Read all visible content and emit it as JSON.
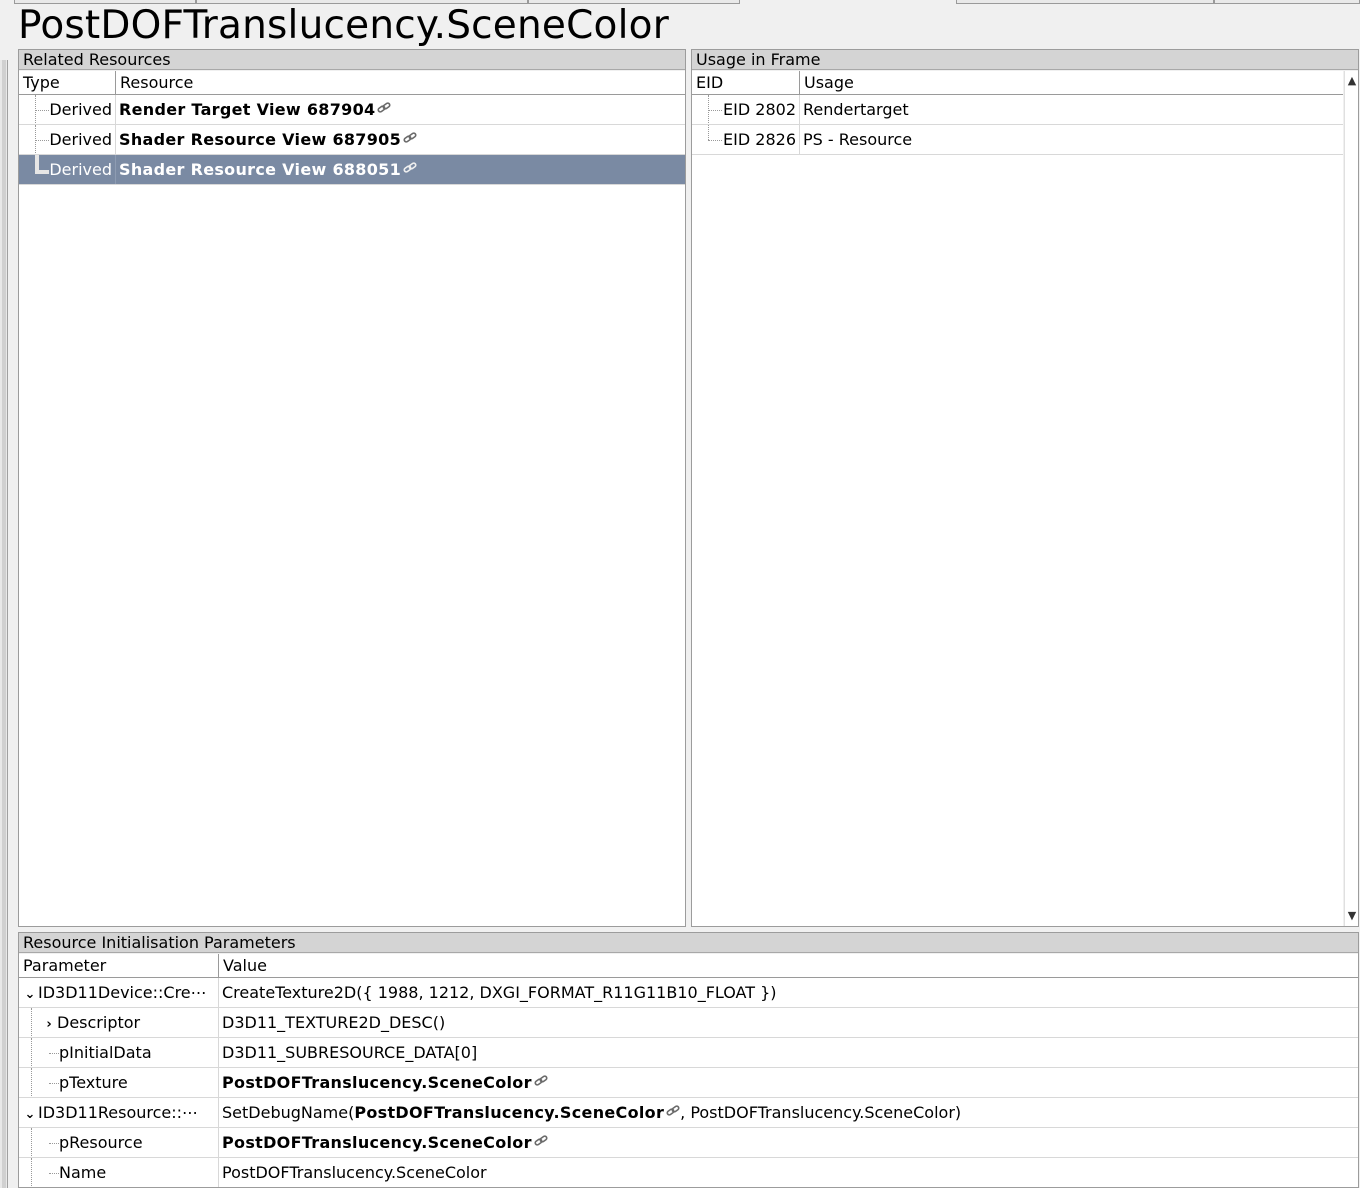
{
  "page": {
    "title": "PostDOFTranslucency.SceneColor"
  },
  "related": {
    "header": "Related Resources",
    "columns": [
      "Type",
      "Resource"
    ],
    "rows": [
      {
        "type": "Derived",
        "resource": "Render Target View 687904",
        "selected": false
      },
      {
        "type": "Derived",
        "resource": "Shader Resource View 687905",
        "selected": false
      },
      {
        "type": "Derived",
        "resource": "Shader Resource View 688051",
        "selected": true
      }
    ]
  },
  "usage": {
    "header": "Usage in Frame",
    "columns": [
      "EID",
      "Usage"
    ],
    "rows": [
      {
        "eid": "EID 2802",
        "usage": "Rendertarget"
      },
      {
        "eid": "EID 2826",
        "usage": "PS - Resource"
      }
    ]
  },
  "init": {
    "header": "Resource Initialisation Parameters",
    "columns": [
      "Parameter",
      "Value"
    ],
    "rows": [
      {
        "param": "ID3D11Device::Cre⋯",
        "value": "CreateTexture2D({ 1988, 1212, DXGI_FORMAT_R11G11B10_FLOAT })",
        "expander": "down"
      },
      {
        "param": "Descriptor",
        "value": "D3D11_TEXTURE2D_DESC()",
        "expander": "right"
      },
      {
        "param": "pInitialData",
        "value": "D3D11_SUBRESOURCE_DATA[0]"
      },
      {
        "param": "pTexture",
        "value": "PostDOFTranslucency.SceneColor",
        "link": true
      },
      {
        "param": "ID3D11Resource::⋯",
        "value_prefix": "SetDebugName(",
        "value_link": "PostDOFTranslucency.SceneColor",
        "value_suffix": ", PostDOFTranslucency.SceneColor)",
        "expander": "down"
      },
      {
        "param": "pResource",
        "value": "PostDOFTranslucency.SceneColor",
        "link": true
      },
      {
        "param": "Name",
        "value": "PostDOFTranslucency.SceneColor"
      }
    ]
  },
  "colors": {
    "selection": "#7a8aa3",
    "header_bg": "#d4d4d4"
  }
}
